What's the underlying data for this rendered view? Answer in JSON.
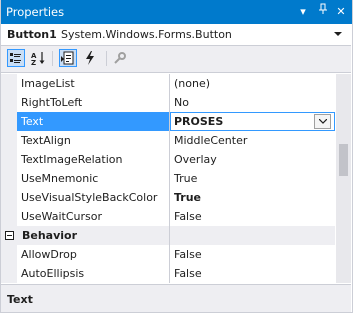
{
  "panel": {
    "title": "Properties",
    "dropdown_glyph": "▾",
    "pin_glyph": "⊥",
    "close_glyph": "✕"
  },
  "object_selector": {
    "name": "Button1",
    "type": "System.Windows.Forms.Button"
  },
  "toolbar": {
    "buttons": [
      {
        "name": "categorized-icon",
        "active": true
      },
      {
        "name": "alphabetical-icon",
        "active": false
      },
      {
        "name": "properties-icon",
        "active": true
      },
      {
        "name": "events-icon",
        "active": false
      },
      {
        "name": "property-pages-icon",
        "active": false
      }
    ]
  },
  "grid": {
    "rows": [
      {
        "name": "ImageList",
        "value": "(none)"
      },
      {
        "name": "RightToLeft",
        "value": "No"
      },
      {
        "name": "Text",
        "value": "PROSES",
        "selected": true
      },
      {
        "name": "TextAlign",
        "value": "MiddleCenter"
      },
      {
        "name": "TextImageRelation",
        "value": "Overlay"
      },
      {
        "name": "UseMnemonic",
        "value": "True"
      },
      {
        "name": "UseVisualStyleBackColor",
        "value": "True",
        "bold": true
      },
      {
        "name": "UseWaitCursor",
        "value": "False"
      },
      {
        "category": true,
        "name": "Behavior",
        "expanded": true
      },
      {
        "name": "AllowDrop",
        "value": "False"
      },
      {
        "name": "AutoEllipsis",
        "value": "False"
      }
    ]
  },
  "description": {
    "title": "Text"
  },
  "colors": {
    "accent": "#007acc",
    "selection": "#3399ff",
    "panel_bg": "#eeeef2"
  }
}
